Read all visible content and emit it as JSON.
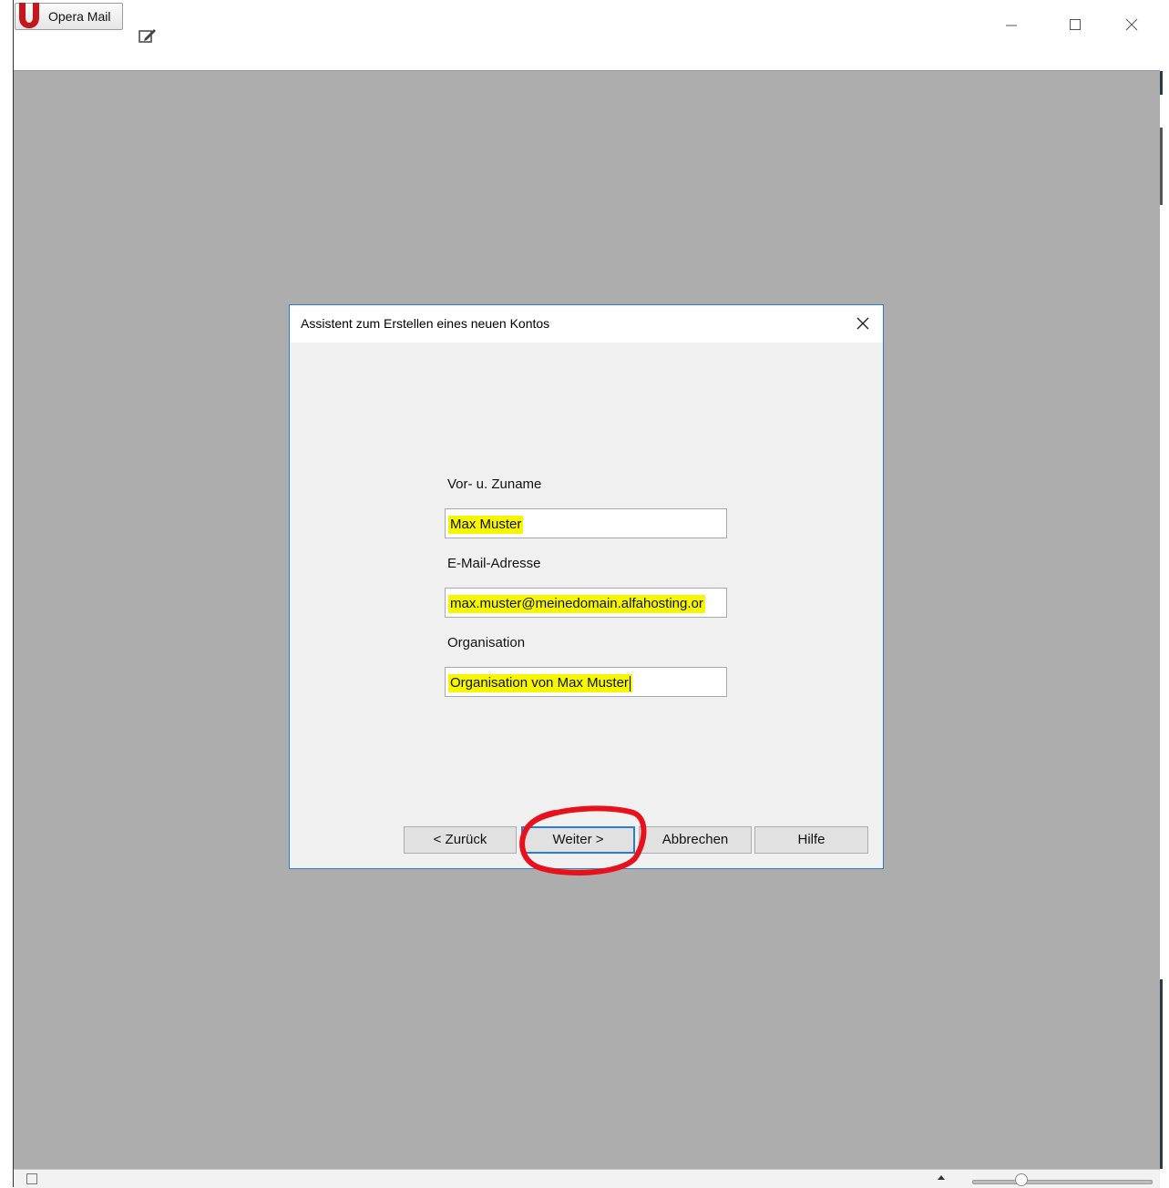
{
  "app": {
    "button_label": "Opera Mail"
  },
  "dialog": {
    "title": "Assistent zum Erstellen eines neuen Kontos",
    "fields": {
      "name": {
        "label": "Vor- u. Zuname",
        "value": "Max Muster"
      },
      "email": {
        "label": "E-Mail-Adresse",
        "value": "max.muster@meinedomain.alfahosting.or"
      },
      "organisation": {
        "label": "Organisation",
        "value": "Organisation von Max Muster"
      }
    },
    "buttons": {
      "back": "< Zurück",
      "next": "Weiter >",
      "cancel": "Abbrechen",
      "help": "Hilfe"
    }
  },
  "colors": {
    "highlight": "#f6f600",
    "annotation": "#e8101a",
    "accent": "#2b7bd8",
    "workspace": "#adadad"
  },
  "icons": [
    "opera-logo-icon",
    "compose-icon",
    "minimize-icon",
    "maximize-icon",
    "close-icon",
    "dialog-close-icon",
    "panel-toggle-icon",
    "zoom-up-icon"
  ]
}
